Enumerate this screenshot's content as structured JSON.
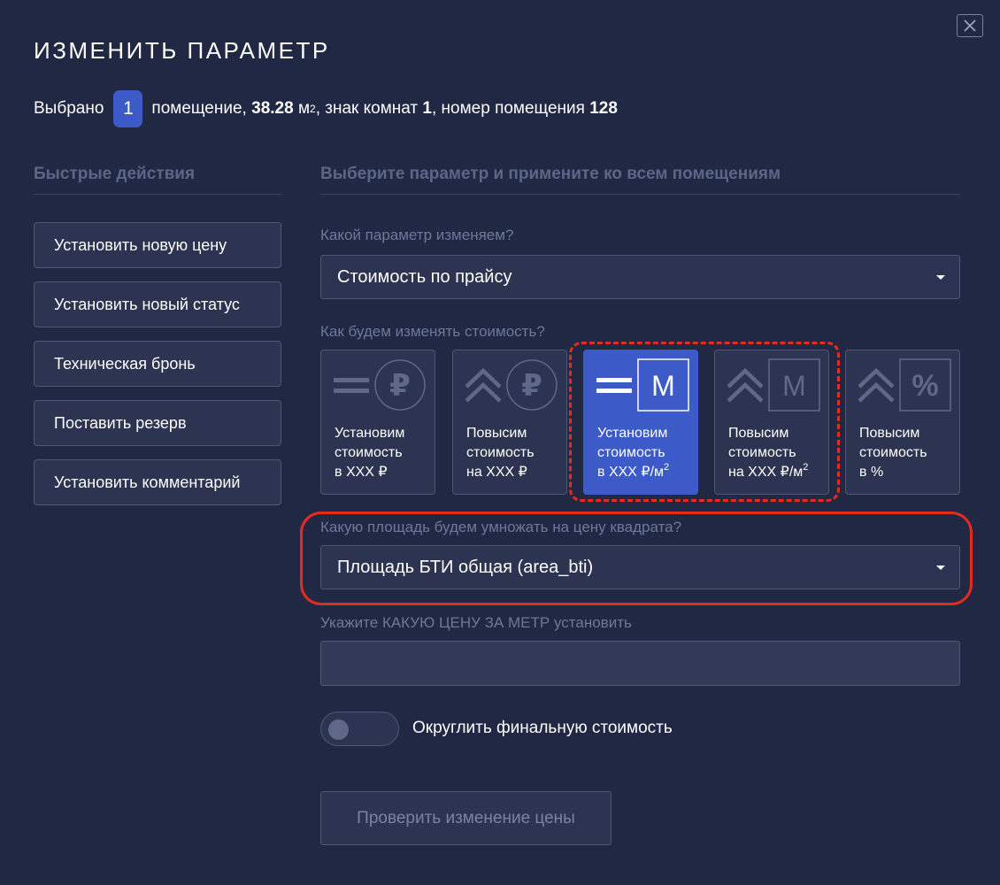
{
  "dialog": {
    "title": "ИЗМЕНИТЬ ПАРАМЕТР",
    "close_icon": "close-icon"
  },
  "selection": {
    "prefix": "Выбрано",
    "count": "1",
    "unit_text": "помещение,",
    "area": "38.28",
    "area_unit": "м",
    "area_sup": "2",
    "rooms_label": ", знак комнат",
    "rooms": "1",
    "number_label": ", номер помещения",
    "number": "128"
  },
  "quick_actions": {
    "heading": "Быстрые действия",
    "items": [
      {
        "label": "Установить новую цену"
      },
      {
        "label": "Установить новый статус"
      },
      {
        "label": "Техническая бронь"
      },
      {
        "label": "Поставить резерв"
      },
      {
        "label": "Установить комментарий"
      }
    ]
  },
  "param_section": {
    "heading": "Выберите параметр и примените ко всем помещениям",
    "param_label": "Какой параметр изменяем?",
    "param_value": "Стоимость по прайсу",
    "method_label": "Как будем изменять стоимость?",
    "methods": [
      {
        "line1": "Установим",
        "line2": "стоимость",
        "line3": "в XXX ₽",
        "sup": "",
        "icon": "equals-ruble-icon",
        "active": false
      },
      {
        "line1": "Повысим",
        "line2": "стоимость",
        "line3": "на XXX ₽",
        "sup": "",
        "icon": "raise-ruble-icon",
        "active": false
      },
      {
        "line1": "Установим",
        "line2": "стоимость",
        "line3": "в XXX ₽/м",
        "sup": "2",
        "icon": "equals-meter-icon",
        "active": true
      },
      {
        "line1": "Повысим",
        "line2": "стоимость",
        "line3": "на XXX ₽/м",
        "sup": "2",
        "icon": "raise-meter-icon",
        "active": false
      },
      {
        "line1": "Повысим",
        "line2": "стоимость",
        "line3": "в %",
        "sup": "",
        "icon": "raise-percent-icon",
        "active": false
      }
    ],
    "area_label": "Какую площадь будем умножать на цену квадрата?",
    "area_value": "Площадь БТИ общая (area_bti)",
    "price_label": "Укажите КАКУЮ ЦЕНУ ЗА МЕТР установить",
    "price_value": "",
    "round_label": "Округлить финальную стоимость",
    "round_enabled": false,
    "check_button": "Проверить изменение цены"
  },
  "colors": {
    "background": "#202844",
    "accent": "#3c5bc9",
    "highlight": "#e32b1f"
  }
}
